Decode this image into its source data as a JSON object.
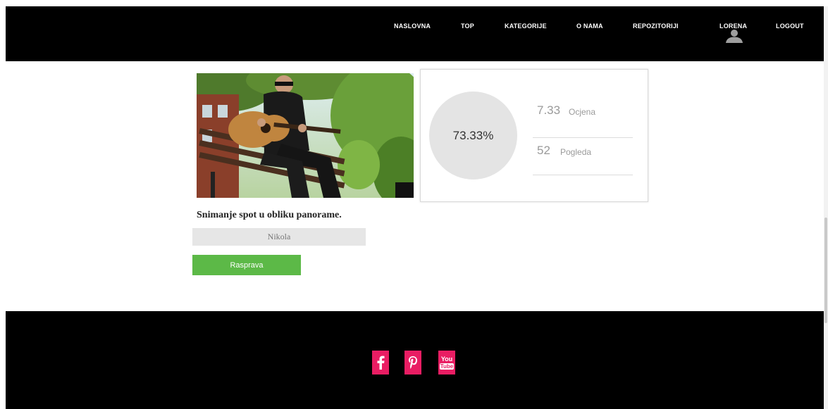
{
  "nav": {
    "items": [
      {
        "label": "NASLOVNA"
      },
      {
        "label": "TOP"
      },
      {
        "label": "KATEGORIJE"
      },
      {
        "label": "O NAMA"
      },
      {
        "label": "REPOZITORIJI"
      },
      {
        "label": "LORENA"
      },
      {
        "label": "LOGOUT"
      }
    ]
  },
  "stats": {
    "percent": "73.33%",
    "rating_value": "7.33",
    "rating_label": "Ocjena",
    "views_value": "52",
    "views_label": "Pogleda"
  },
  "video": {
    "title": "Snimanje spot u obliku panorame.",
    "author": "Nikola",
    "discuss_button": "Rasprava"
  },
  "footer": {
    "youtube_line1": "You",
    "youtube_line2": "Tube"
  },
  "colors": {
    "header_bg": "#000000",
    "accent_green": "#5cb947",
    "social_pink": "#e91d63"
  },
  "icons": [
    "user-icon",
    "facebook-icon",
    "pinterest-icon",
    "youtube-icon"
  ]
}
